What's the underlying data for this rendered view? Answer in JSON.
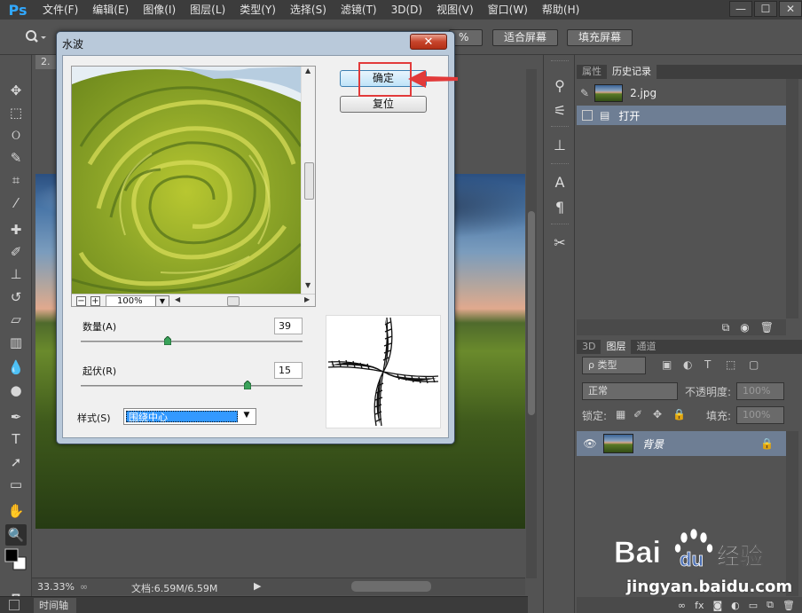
{
  "app": {
    "logo": "Ps",
    "menu": [
      "文件(F)",
      "编辑(E)",
      "图像(I)",
      "图层(L)",
      "类型(Y)",
      "选择(S)",
      "滤镜(T)",
      "3D(D)",
      "视图(V)",
      "窗口(W)",
      "帮助(H)"
    ],
    "window_controls": [
      "—",
      "☐",
      "✕"
    ]
  },
  "options_bar": {
    "zoom_partial": "%",
    "fit_screen": "适合屏幕",
    "fill_screen": "填充屏幕"
  },
  "document": {
    "tab_label": "2.",
    "zoom_percent": "33.33%",
    "doc_info": "文档:6.59M/6.59M",
    "timeline": "时间轴"
  },
  "panels": {
    "history_tabs": [
      "属性",
      "历史记录"
    ],
    "history_snapshot": "2.jpg",
    "history_step": "打开",
    "layers_tabs": [
      "3D",
      "图层",
      "通道"
    ],
    "filter_kind": "ρ 类型",
    "blend_mode": "正常",
    "opacity_label": "不透明度:",
    "opacity_value": "100%",
    "lock_label": "锁定:",
    "fill_label": "填充:",
    "fill_value": "100%",
    "layer_name": "背景"
  },
  "dialog": {
    "title": "水波",
    "close": "✕",
    "ok": "确定",
    "reset": "复位",
    "preview_zoom": "100%",
    "amount_label": "数量(A)",
    "amount_value": "39",
    "amount_level": 0.39,
    "ridges_label": "起伏(R)",
    "ridges_value": "15",
    "ridges_level": 0.75,
    "style_label": "样式(S)",
    "style_value": "围绕中心"
  },
  "watermark": {
    "brand": "Bai",
    "brand2": "du",
    "cn": "经验",
    "url": "jingyan.baidu.com"
  },
  "colors": {
    "accent": "#31a8ff",
    "highlight": "#e23a3a",
    "selection": "#3399ff"
  }
}
